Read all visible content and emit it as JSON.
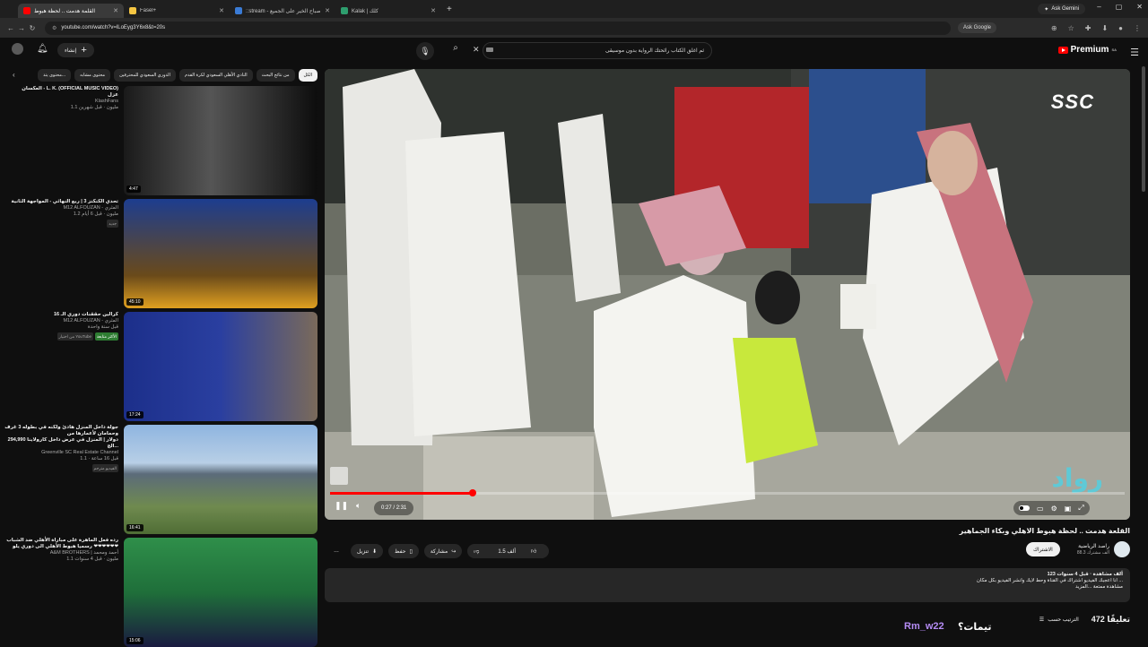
{
  "browser": {
    "tabs": [
      {
        "title": "القلمة هدمت .. لحظة هبوط",
        "icon": "youtube-icon",
        "color": "#ff0000"
      },
      {
        "title": "Fasel+",
        "icon": "heart-icon",
        "color": "#f4c542"
      },
      {
        "title": "::stream - صباح الخير على الجميع",
        "icon": "globe-icon",
        "color": "#3a7bd5"
      },
      {
        "title": "Kalak | كلك",
        "icon": "doc-icon",
        "color": "#2e9e6e"
      }
    ],
    "new_tab": "+",
    "ask_gemini": "Ask Gemini",
    "url": "youtube.com/watch?v=lLoEyg3Y6x8&t=20s",
    "ask_google": "Ask Google"
  },
  "youtube": {
    "premium_label": "Premium",
    "premium_sup": "SA",
    "search_query": "ثم اغلق الكتاب رائحتك الرواية بدون موسيقى",
    "create_label": "إنشاء"
  },
  "chips": [
    "الكل",
    "من نتائج البحث",
    "النادي الأهلي السعودي لكرة القدم",
    "الدوري السعودي للمحترفين",
    "محتوى مشابه",
    "محتوى يتذ..."
  ],
  "recommendations": [
    {
      "title": "العكسان - L. K. (OFFICIAL MUSIC VIDEO)",
      "title2": "عزل",
      "channel": "KlashFans",
      "meta": "1.1 مليون · قبل شهرين",
      "duration": "4:47",
      "badges": [],
      "theme": "dark"
    },
    {
      "title": "تحدي الكنكنز 3 | ربع النهائي - المواجهة الثانية",
      "title2": "",
      "channel": "M12 ALFOUZAN - المثري",
      "meta": "1.2 مليون · قبل 6 أيام",
      "duration": "45:10",
      "badges": [
        "جديد"
      ],
      "theme": "blue"
    },
    {
      "title": "كرالين حققنات دوري الـ 16",
      "title2": "",
      "channel": "M12 ALFOUZAN - المثري",
      "meta": "قبل سنة واحدة",
      "duration": "17:24",
      "badges": [
        "من اختيار YouTube",
        "الأكثر متابعة"
      ],
      "theme": "studio"
    },
    {
      "title": "جولة داخل المنزل هادئ ولكنه في بطوله 3 غرف وحمامان لأعمارها من",
      "title2": "294,990 دولار | المنزل في عرض داخل كارولاينا الج...",
      "channel": "Greenville SC Real Estate Channel",
      "meta": "1.1 · قبل 16 ساعة",
      "duration": "16:41",
      "badges": [
        "الفيديو مترجم"
      ],
      "theme": "house"
    },
    {
      "title": "رده فعل الماهرة على مباراة الأهلي ضد الشباب",
      "title2": "رسميا هبوط الأهلي الى دوري يلو ❤❤❤❤❤❤",
      "channel": "A&M BROTHERS | أحمد ومحمد",
      "meta": "1.1 مليون · قبل 4 سنوات",
      "duration": "15:06",
      "badges": [],
      "theme": "green"
    }
  ],
  "player": {
    "watermark": "SSC",
    "logo_text": "رواد",
    "current_time": "0:27",
    "total_time": "2:31",
    "progress": 0.18
  },
  "video": {
    "title": "القلعة هدمت .. لحظة هبوط الاهلي وبكاء الجماهير",
    "channel": "راصد الرياضية",
    "subscribers": "88.3 ألف مشترك",
    "subscribe_label": "الاشتراك",
    "likes": "1.5 ألف",
    "share": "مشاركة",
    "save": "حفظ",
    "download": "تنزيل",
    "more": "…"
  },
  "description": {
    "stats": "123 ألف مشاهدة · قبل 4 سنوات",
    "line1": "انا اعجبك الفيديو اشتراك في القناة وحط لايك وانشر الفيديو بكل مكان ...",
    "line2": "مشاهدة ممتعة ...المزيد"
  },
  "comments": {
    "count": "472 تعليقًا",
    "sort": "الترتيب حسب"
  },
  "overlay": {
    "question": "تيمات؟",
    "user": "Rm_w22"
  },
  "colors": {
    "accent": "#ff0000",
    "background": "#0f0f0f",
    "chip": "#272727",
    "overlay_user": "#b58cf5"
  }
}
